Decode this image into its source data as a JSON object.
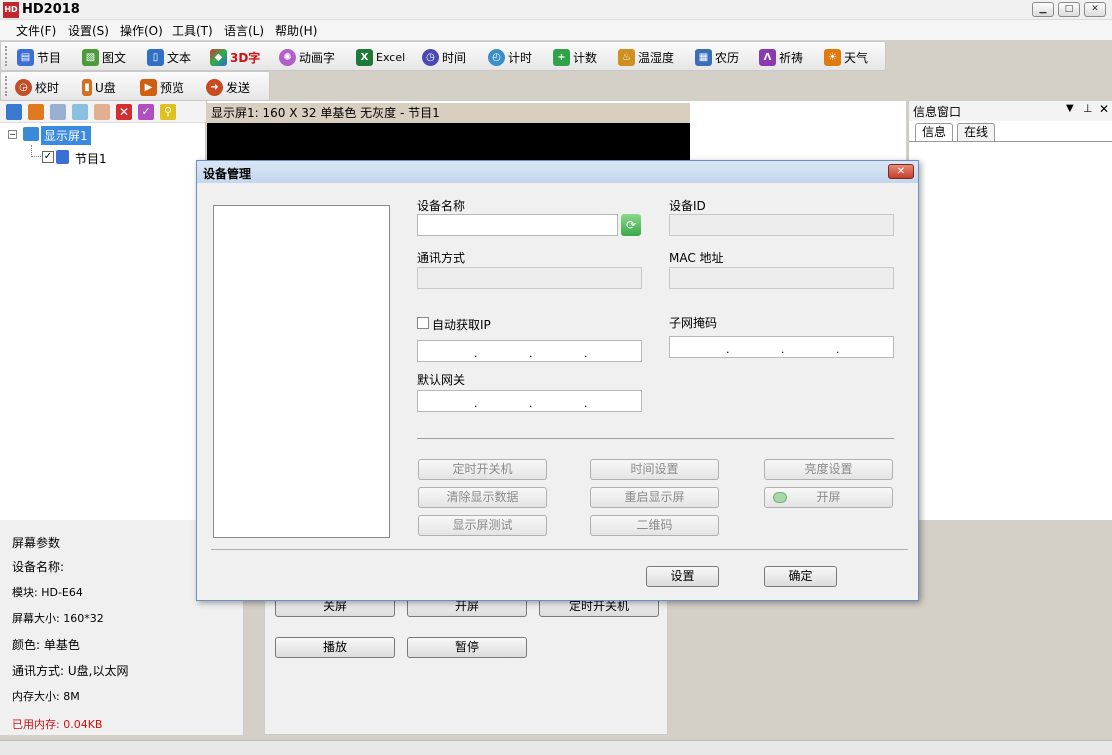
{
  "window": {
    "title": "HD2018",
    "logo": "HD"
  },
  "menu": [
    "文件(F)",
    "设置(S)",
    "操作(O)",
    "工具(T)",
    "语言(L)",
    "帮助(H)"
  ],
  "toolbar1": [
    {
      "label": "节目",
      "icon": "program-icon",
      "color": "#3b6fd6"
    },
    {
      "label": "图文",
      "icon": "image-text-icon",
      "color": "#4b9a3c"
    },
    {
      "label": "文本",
      "icon": "text-book-icon",
      "color": "#2f70c4"
    },
    {
      "label": "3D字",
      "icon": "cube-3d-icon",
      "color": "#e0a020"
    },
    {
      "label": "动画字",
      "icon": "animation-icon",
      "color": "#b060c8"
    },
    {
      "label": "Excel",
      "icon": "excel-icon",
      "color": "#1f7a3a"
    },
    {
      "label": "时间",
      "icon": "clock-icon",
      "color": "#4a4ab0"
    },
    {
      "label": "计时",
      "icon": "timer-icon",
      "color": "#3a8fc8"
    },
    {
      "label": "计数",
      "icon": "counter-icon",
      "color": "#2fa24a"
    },
    {
      "label": "温湿度",
      "icon": "thermometer-icon",
      "color": "#d09020"
    },
    {
      "label": "农历",
      "icon": "calendar-icon",
      "color": "#3a6fb8"
    },
    {
      "label": "祈祷",
      "icon": "prayer-icon",
      "color": "#8a3ab0"
    },
    {
      "label": "天气",
      "icon": "weather-icon",
      "color": "#e07a10"
    }
  ],
  "toolbar2": [
    {
      "label": "校时",
      "icon": "sync-time-icon",
      "color": "#c0502a"
    },
    {
      "label": "U盘",
      "icon": "usb-icon",
      "color": "#d07020"
    },
    {
      "label": "预览",
      "icon": "preview-camera-icon",
      "color": "#d06010"
    },
    {
      "label": "发送",
      "icon": "send-icon",
      "color": "#c84a20"
    }
  ],
  "tree": {
    "screen": "显示屏1",
    "program": "节目1"
  },
  "preview_label": "显示屏1: 160 X 32  单基色  无灰度 - 节目1",
  "info": {
    "title": "信息窗口",
    "tabs": [
      "信息",
      "在线"
    ]
  },
  "params": {
    "title": "屏幕参数",
    "device_name": "设备名称:",
    "module": "模块: HD-E64",
    "screen_size": "屏幕大小: 160*32",
    "color": "颜色: 单基色",
    "comm": "通讯方式: U盘,以太网",
    "memory": "内存大小: 8M",
    "used_memory": "已用内存: 0.04KB",
    "used_memory_color": "#d01010"
  },
  "controls": {
    "off": "关屏",
    "on": "开屏",
    "timer": "定时开关机",
    "play": "播放",
    "pause": "暂停"
  },
  "dialog": {
    "title": "设备管理",
    "device_name_label": "设备名称",
    "device_id_label": "设备ID",
    "comm_label": "通讯方式",
    "mac_label": "MAC 地址",
    "auto_ip_label": "自动获取IP",
    "subnet_label": "子网掩码",
    "gateway_label": "默认网关",
    "buttons": {
      "timer": "定时开关机",
      "time_set": "时间设置",
      "brightness": "亮度设置",
      "clear": "清除显示数据",
      "restart": "重启显示屏",
      "screen_on": "开屏",
      "test": "显示屏测试",
      "qrcode": "二维码",
      "set": "设置",
      "ok": "确定"
    }
  }
}
